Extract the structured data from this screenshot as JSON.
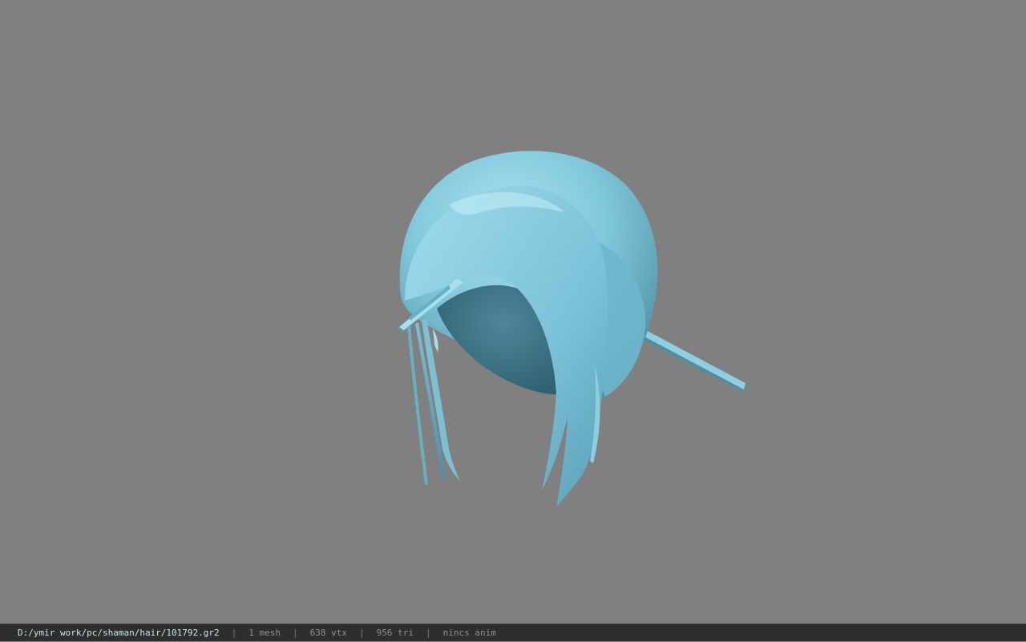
{
  "viewer": {
    "background_color": "#808080",
    "model_color": "#7fc6dc",
    "model": "hair-mesh"
  },
  "status": {
    "file_path": "D:/ymir work/pc/shaman/hair/101792.gr2",
    "separator": "|",
    "mesh_count": "1 mesh",
    "vertex_count": "638 vtx",
    "triangle_count": "956 tri",
    "anim_status": "nincs anim"
  }
}
